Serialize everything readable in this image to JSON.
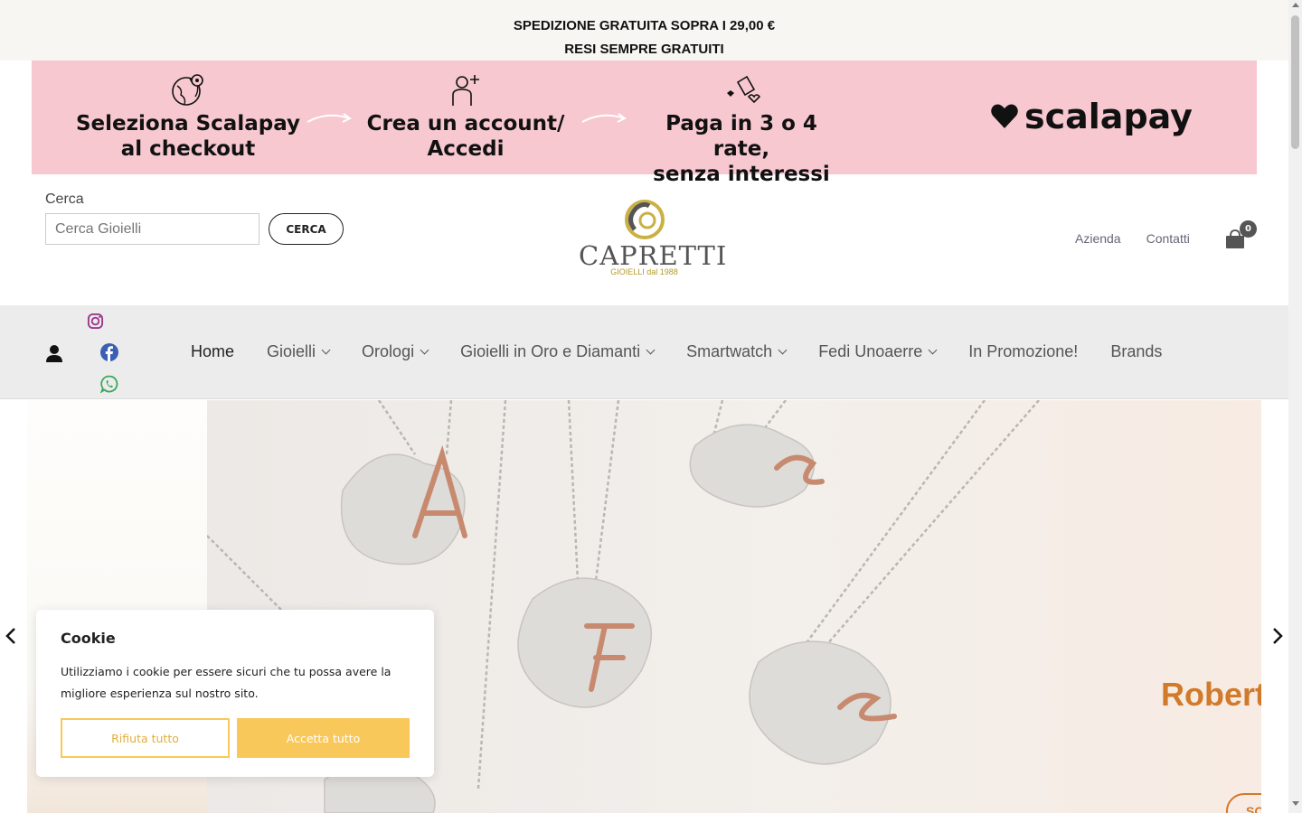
{
  "announcement": {
    "line1": "SPEDIZIONE GRATUITA SOPRA I 29,00 €",
    "line2": "RESI SEMPRE GRATUITI"
  },
  "banner": {
    "steps": [
      {
        "line1": "Seleziona Scalapay",
        "line2": "al checkout",
        "icon": "globe-icon"
      },
      {
        "line1": "Crea un account/",
        "line2": "Accedi",
        "icon": "add-user-icon"
      },
      {
        "line1": "Paga in 3 o 4 rate,",
        "line2": "senza interessi",
        "icon": "hearts-icon"
      }
    ],
    "brand": "scalapay",
    "bg_color": "#f7c8d0"
  },
  "search": {
    "label": "Cerca",
    "placeholder": "Cerca Gioielli",
    "button": "CERCA"
  },
  "logo": {
    "name": "CAPRETTI",
    "tagline": "GIOIELLI dal 1988"
  },
  "header_links": [
    "Azienda",
    "Contatti"
  ],
  "cart": {
    "count": "0",
    "icon": "shopping-bag-icon"
  },
  "nav": {
    "items": [
      {
        "label": "Home",
        "dropdown": false,
        "active": true
      },
      {
        "label": "Gioielli",
        "dropdown": true
      },
      {
        "label": "Orologi",
        "dropdown": true
      },
      {
        "label": "Gioielli in Oro e Diamanti",
        "dropdown": true
      },
      {
        "label": "Smartwatch",
        "dropdown": true
      },
      {
        "label": "Fedi Unoaerre",
        "dropdown": true
      },
      {
        "label": "In Promozione!",
        "dropdown": false
      },
      {
        "label": "Brands",
        "dropdown": false
      }
    ],
    "social": [
      "instagram-icon",
      "facebook-icon",
      "whatsapp-icon"
    ]
  },
  "hero": {
    "brand_text": "Roberto",
    "cta_text": "SC"
  },
  "cookie": {
    "title": "Cookie",
    "text": "Utilizziamo i cookie per essere sicuri che tu possa avere la migliore esperienza sul nostro sito.",
    "reject": "Rifiuta tutto",
    "accept": "Accetta tutto",
    "accent": "#f9c85b"
  }
}
